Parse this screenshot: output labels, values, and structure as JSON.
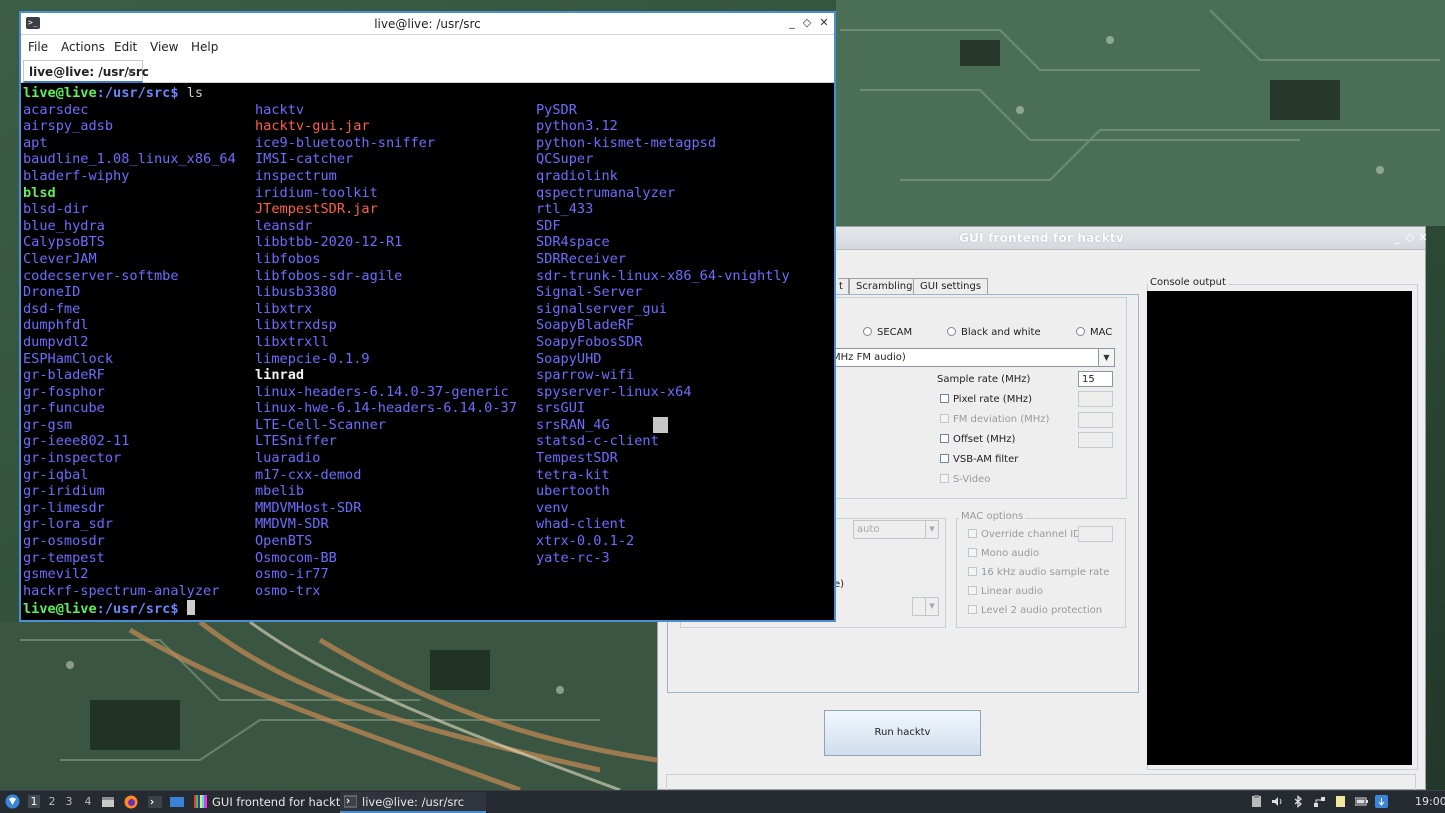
{
  "terminal": {
    "title": "live@live: /usr/src",
    "menu": [
      "File",
      "Actions",
      "Edit",
      "View",
      "Help"
    ],
    "tab_label": "live@live: /usr/src",
    "tab_close": "×",
    "prompt_user": "live@live",
    "prompt_path": ":/usr/src$",
    "command": " ls",
    "window_buttons": {
      "minimize": "_",
      "maximize": "◇",
      "close": "✕"
    },
    "columns": [
      [
        {
          "name": "acarsdec",
          "kind": "dir"
        },
        {
          "name": "airspy_adsb",
          "kind": "dir"
        },
        {
          "name": "apt",
          "kind": "dir"
        },
        {
          "name": "baudline_1.08_linux_x86_64",
          "kind": "dir"
        },
        {
          "name": "bladerf-wiphy",
          "kind": "dir"
        },
        {
          "name": "blsd",
          "kind": "exec"
        },
        {
          "name": "blsd-dir",
          "kind": "dir"
        },
        {
          "name": "blue_hydra",
          "kind": "dir"
        },
        {
          "name": "CalypsoBTS",
          "kind": "dir"
        },
        {
          "name": "CleverJAM",
          "kind": "dir"
        },
        {
          "name": "codecserver-softmbe",
          "kind": "dir"
        },
        {
          "name": "DroneID",
          "kind": "dir"
        },
        {
          "name": "dsd-fme",
          "kind": "dir"
        },
        {
          "name": "dumphfdl",
          "kind": "dir"
        },
        {
          "name": "dumpvdl2",
          "kind": "dir"
        },
        {
          "name": "ESPHamClock",
          "kind": "dir"
        },
        {
          "name": "gr-bladeRF",
          "kind": "dir"
        },
        {
          "name": "gr-fosphor",
          "kind": "dir"
        },
        {
          "name": "gr-funcube",
          "kind": "dir"
        },
        {
          "name": "gr-gsm",
          "kind": "dir"
        },
        {
          "name": "gr-ieee802-11",
          "kind": "dir"
        },
        {
          "name": "gr-inspector",
          "kind": "dir"
        },
        {
          "name": "gr-iqbal",
          "kind": "dir"
        },
        {
          "name": "gr-iridium",
          "kind": "dir"
        },
        {
          "name": "gr-limesdr",
          "kind": "dir"
        },
        {
          "name": "gr-lora_sdr",
          "kind": "dir"
        },
        {
          "name": "gr-osmosdr",
          "kind": "dir"
        },
        {
          "name": "gr-tempest",
          "kind": "dir"
        },
        {
          "name": "gsmevil2",
          "kind": "dir"
        },
        {
          "name": "hackrf-spectrum-analyzer",
          "kind": "dir"
        }
      ],
      [
        {
          "name": "hacktv",
          "kind": "dir"
        },
        {
          "name": "hacktv-gui.jar",
          "kind": "jar"
        },
        {
          "name": "ice9-bluetooth-sniffer",
          "kind": "dir"
        },
        {
          "name": "IMSI-catcher",
          "kind": "dir"
        },
        {
          "name": "inspectrum",
          "kind": "dir"
        },
        {
          "name": "iridium-toolkit",
          "kind": "dir"
        },
        {
          "name": "JTempestSDR.jar",
          "kind": "jar"
        },
        {
          "name": "leansdr",
          "kind": "dir"
        },
        {
          "name": "libbtbb-2020-12-R1",
          "kind": "dir"
        },
        {
          "name": "libfobos",
          "kind": "dir"
        },
        {
          "name": "libfobos-sdr-agile",
          "kind": "dir"
        },
        {
          "name": "libusb3380",
          "kind": "dir"
        },
        {
          "name": "libxtrx",
          "kind": "dir"
        },
        {
          "name": "libxtrxdsp",
          "kind": "dir"
        },
        {
          "name": "libxtrxll",
          "kind": "dir"
        },
        {
          "name": "limepcie-0.1.9",
          "kind": "dir"
        },
        {
          "name": "linrad",
          "kind": "white"
        },
        {
          "name": "linux-headers-6.14.0-37-generic",
          "kind": "dir"
        },
        {
          "name": "linux-hwe-6.14-headers-6.14.0-37",
          "kind": "dir"
        },
        {
          "name": "LTE-Cell-Scanner",
          "kind": "dir"
        },
        {
          "name": "LTESniffer",
          "kind": "dir"
        },
        {
          "name": "luaradio",
          "kind": "dir"
        },
        {
          "name": "m17-cxx-demod",
          "kind": "dir"
        },
        {
          "name": "mbelib",
          "kind": "dir"
        },
        {
          "name": "MMDVMHost-SDR",
          "kind": "dir"
        },
        {
          "name": "MMDVM-SDR",
          "kind": "dir"
        },
        {
          "name": "OpenBTS",
          "kind": "dir"
        },
        {
          "name": "Osmocom-BB",
          "kind": "dir"
        },
        {
          "name": "osmo-ir77",
          "kind": "dir"
        },
        {
          "name": "osmo-trx",
          "kind": "dir"
        }
      ],
      [
        {
          "name": "PySDR",
          "kind": "dir"
        },
        {
          "name": "python3.12",
          "kind": "dir"
        },
        {
          "name": "python-kismet-metagpsd",
          "kind": "dir"
        },
        {
          "name": "QCSuper",
          "kind": "dir"
        },
        {
          "name": "qradiolink",
          "kind": "dir"
        },
        {
          "name": "qspectrumanalyzer",
          "kind": "dir"
        },
        {
          "name": "rtl_433",
          "kind": "dir"
        },
        {
          "name": "SDF",
          "kind": "dir"
        },
        {
          "name": "SDR4space",
          "kind": "dir"
        },
        {
          "name": "SDRReceiver",
          "kind": "dir"
        },
        {
          "name": "sdr-trunk-linux-x86_64-vnightly",
          "kind": "dir"
        },
        {
          "name": "Signal-Server",
          "kind": "dir"
        },
        {
          "name": "signalserver_gui",
          "kind": "dir"
        },
        {
          "name": "SoapyBladeRF",
          "kind": "dir"
        },
        {
          "name": "SoapyFobosSDR",
          "kind": "dir"
        },
        {
          "name": "SoapyUHD",
          "kind": "dir"
        },
        {
          "name": "sparrow-wifi",
          "kind": "dir"
        },
        {
          "name": "spyserver-linux-x64",
          "kind": "dir"
        },
        {
          "name": "srsGUI",
          "kind": "dir"
        },
        {
          "name": "srsRAN_4G",
          "kind": "dir"
        },
        {
          "name": "statsd-c-client",
          "kind": "dir"
        },
        {
          "name": "TempestSDR",
          "kind": "dir"
        },
        {
          "name": "tetra-kit",
          "kind": "dir"
        },
        {
          "name": "ubertooth",
          "kind": "dir"
        },
        {
          "name": "venv",
          "kind": "dir"
        },
        {
          "name": "whad-client",
          "kind": "dir"
        },
        {
          "name": "xtrx-0.0.1-2",
          "kind": "dir"
        },
        {
          "name": "yate-rc-3",
          "kind": "dir"
        }
      ]
    ]
  },
  "gui": {
    "title": "GUI frontend for hacktv",
    "window_buttons": {
      "minimize": "_",
      "maximize": "◇",
      "close": "✕"
    },
    "tabs": [
      "t",
      "Scrambling",
      "GUI settings"
    ],
    "radios": [
      "SECAM",
      "Black and white",
      "MAC"
    ],
    "mode_combo": "MHz FM audio)",
    "sample_rate_label": "Sample rate (MHz)",
    "sample_rate_value": "15",
    "checks": [
      {
        "label": "Pixel rate (MHz)",
        "enabled": true
      },
      {
        "label": "FM deviation (MHz)",
        "enabled": false
      },
      {
        "label": "Offset (MHz)",
        "enabled": true
      },
      {
        "label": "VSB-AM filter",
        "enabled": true
      },
      {
        "label": "S-Video",
        "enabled": false
      }
    ],
    "auto_combo": "auto",
    "partial_label": "e)",
    "mac_options_title": "MAC options",
    "mac_checks": [
      "Override channel ID",
      "Mono audio",
      "16 kHz audio sample rate",
      "Linear audio",
      "Level 2 audio protection"
    ],
    "run_button": "Run hacktv",
    "console_title": "Console output"
  },
  "taskbar": {
    "workspaces": [
      "1",
      "2",
      "3",
      "4"
    ],
    "tasks": [
      "GUI frontend for hacktv",
      "live@live: /usr/src"
    ],
    "clock": "19:00"
  },
  "colors": {
    "accent": "#4a8fd3",
    "dir": "#6f6cff",
    "jar": "#ff5f4a",
    "exec": "#62ec5e",
    "prompt": "#5ff05a"
  }
}
